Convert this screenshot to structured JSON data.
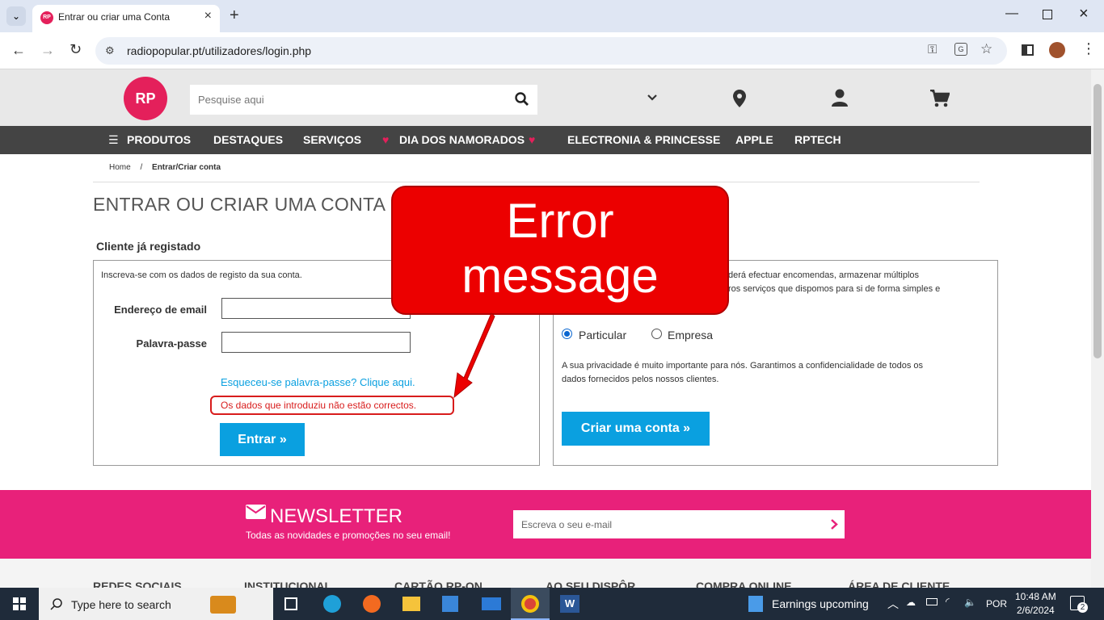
{
  "browser": {
    "tab_title": "Entrar ou criar uma Conta",
    "url": "radiopopular.pt/utilizadores/login.php",
    "favicon_text": "RP"
  },
  "site": {
    "logo_text": "RP",
    "search_placeholder": "Pesquise aqui",
    "nav": [
      "PRODUTOS",
      "DESTAQUES",
      "SERVIÇOS",
      "DIA DOS NAMORADOS",
      "ELECTRONIA & PRINCESSE",
      "APPLE",
      "RPTECH"
    ],
    "breadcrumb": {
      "home": "Home",
      "sep": "/",
      "current": "Entrar/Criar conta"
    },
    "page_title": "ENTRAR OU CRIAR UMA CONTA"
  },
  "login": {
    "section_title": "Cliente já registado",
    "intro": "Inscreva-se com os dados de registo da sua conta.",
    "email_label": "Endereço de email",
    "password_label": "Palavra-passe",
    "forgot_link": "Esqueceu-se palavra-passe? Clique aqui.",
    "error": "Os dados que introduziu não estão correctos.",
    "submit": "Entrar »"
  },
  "register": {
    "intro_line1": "derá efectuar encomendas, armazenar múltiplos",
    "intro_line2": "ros serviços que dispomos para si de forma simples e",
    "option_particular": "Particular",
    "option_empresa": "Empresa",
    "privacy": "A sua privacidade é muito importante para nós. Garantimos a confidencialidade de todos os",
    "privacy_line2": "dados fornecidos pelos nossos clientes.",
    "submit": "Criar uma conta »"
  },
  "callout": {
    "line1": "Error",
    "line2": "message"
  },
  "newsletter": {
    "title": "NEWSLETTER",
    "subtitle": "Todas as novidades e promoções no seu email!",
    "placeholder": "Escreva o seu e-mail"
  },
  "footer": [
    "REDES SOCIAIS",
    "INSTITUCIONAL",
    "CARTÃO RP-ON",
    "AO SEU DISPÔR",
    "COMPRA ONLINE",
    "ÁREA DE CLIENTE"
  ],
  "taskbar": {
    "search_placeholder": "Type here to search",
    "weather": "Earnings upcoming",
    "lang": "POR",
    "time": "10:48 AM",
    "date": "2/6/2024",
    "notifications": "2"
  }
}
